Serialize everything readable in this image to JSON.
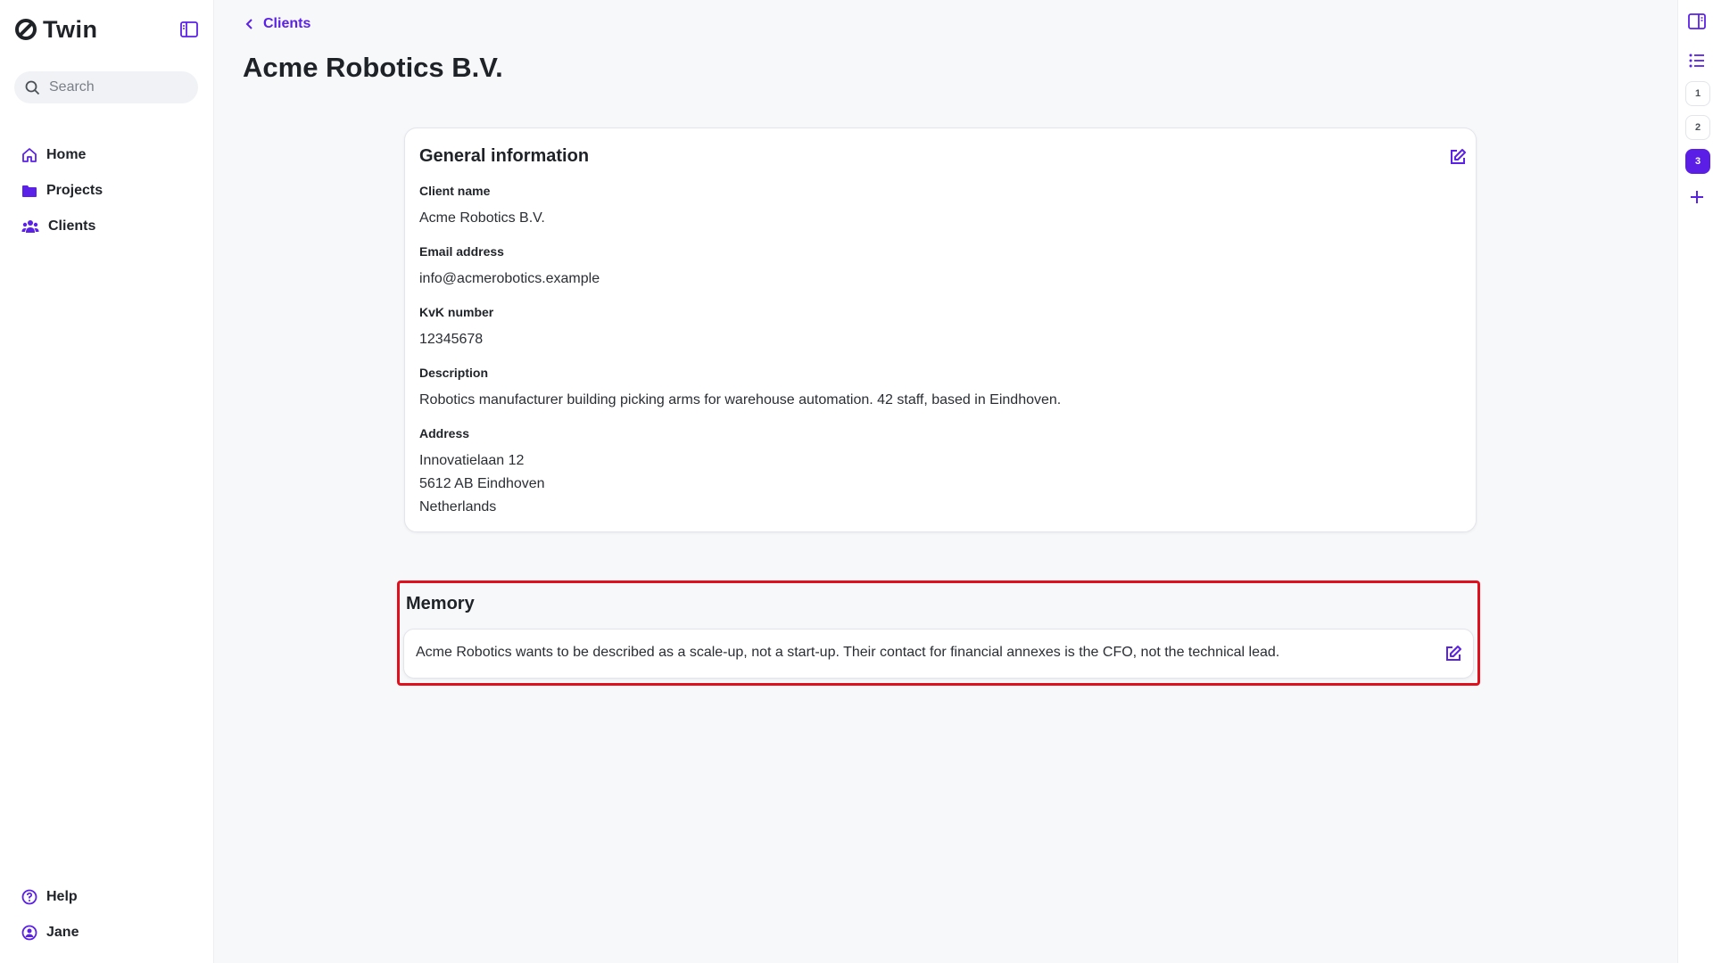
{
  "app": {
    "name": "Twin",
    "accent": "#5b21e6",
    "highlight": "#e0101d"
  },
  "sidebar": {
    "search_placeholder": "Search",
    "nav": [
      {
        "label": "Home",
        "icon": "home-icon"
      },
      {
        "label": "Projects",
        "icon": "folder-icon"
      },
      {
        "label": "Clients",
        "icon": "users-icon"
      }
    ],
    "bottom": [
      {
        "label": "Help",
        "icon": "help-icon"
      },
      {
        "label": "Jane",
        "icon": "user-circle-icon"
      }
    ]
  },
  "breadcrumb": {
    "label": "Clients"
  },
  "page": {
    "title": "Acme Robotics B.V."
  },
  "general": {
    "title": "General information",
    "fields": [
      {
        "label": "Client name",
        "value": "Acme Robotics B.V."
      },
      {
        "label": "Email address",
        "value": "info@acmerobotics.example"
      },
      {
        "label": "KvK number",
        "value": "12345678"
      },
      {
        "label": "Description",
        "value": "Robotics manufacturer building picking arms for warehouse automation. 42 staff, based in Eindhoven."
      },
      {
        "label": "Address",
        "lines": [
          "Innovatielaan 12",
          "5612 AB Eindhoven",
          "Netherlands"
        ]
      }
    ]
  },
  "memory": {
    "title": "Memory",
    "text": "Acme Robotics wants to be described as a scale-up, not a start-up. Their contact for financial annexes is the CFO, not the technical lead."
  },
  "rightbar": {
    "pages": [
      "1",
      "2",
      "3"
    ],
    "active_page": "3"
  }
}
